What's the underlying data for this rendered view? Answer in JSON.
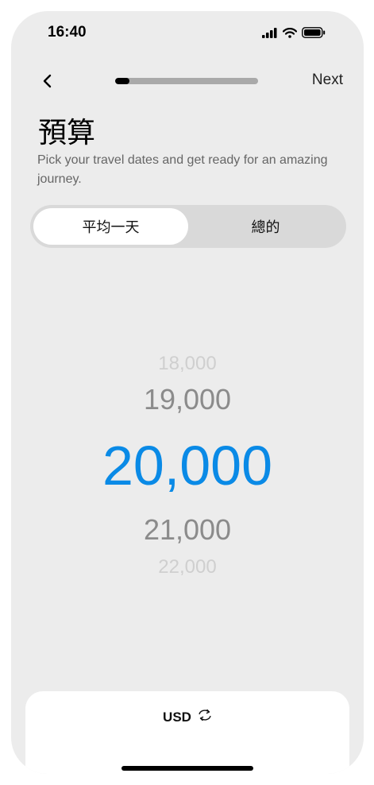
{
  "status_bar": {
    "time": "16:40"
  },
  "header": {
    "next_label": "Next",
    "progress": 0.1
  },
  "title": "預算",
  "subtitle": "Pick your travel dates and get ready for an amazing journey.",
  "segment": {
    "options": [
      "平均一天",
      "總的"
    ],
    "selected_index": 0
  },
  "picker": {
    "values": [
      "18,000",
      "19,000",
      "20,000",
      "21,000",
      "22,000"
    ],
    "selected": "20,000"
  },
  "currency": {
    "label": "USD"
  },
  "colors": {
    "accent": "#0a8ae6",
    "background": "#ececec"
  }
}
